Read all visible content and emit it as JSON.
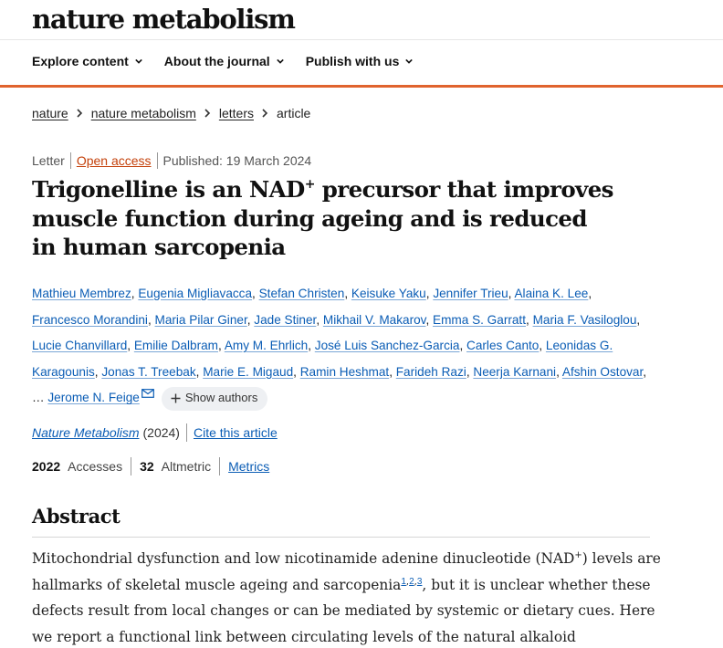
{
  "header": {
    "logo": "nature metabolism"
  },
  "nav": [
    {
      "label": "Explore content"
    },
    {
      "label": "About the journal"
    },
    {
      "label": "Publish with us"
    }
  ],
  "breadcrumbs": [
    "nature",
    "nature metabolism",
    "letters",
    "article"
  ],
  "meta": {
    "type": "Letter",
    "access": "Open access",
    "published": "Published: 19 March 2024"
  },
  "title": {
    "part1": "Trigonelline is an NAD",
    "sup": "+",
    "part2": " precursor that improves muscle function during ageing and is reduced in human sarcopenia"
  },
  "authors": [
    "Mathieu Membrez",
    "Eugenia Migliavacca",
    "Stefan Christen",
    "Keisuke Yaku",
    "Jennifer Trieu",
    "Alaina K. Lee",
    "Francesco Morandini",
    "Maria Pilar Giner",
    "Jade Stiner",
    "Mikhail V. Makarov",
    "Emma S. Garratt",
    "Maria F. Vasiloglou",
    "Lucie Chanvillard",
    "Emilie Dalbram",
    "Amy M. Ehrlich",
    "José Luis Sanchez-Garcia",
    "Carles Canto",
    "Leonidas G. Karagounis",
    "Jonas T. Treebak",
    "Marie E. Migaud",
    "Ramin Heshmat",
    "Farideh Razi",
    "Neerja Karnani",
    "Afshin Ostovar",
    "Jerome N. Feige"
  ],
  "authors_ellipsis": "…",
  "show_authors_label": "Show authors",
  "journal": {
    "name": "Nature Metabolism",
    "year": "(2024)",
    "cite": "Cite this article"
  },
  "metrics": {
    "accesses_value": "2022",
    "accesses_label": "Accesses",
    "altmetric_value": "32",
    "altmetric_label": "Altmetric",
    "metrics_link": "Metrics"
  },
  "abstract": {
    "heading": "Abstract",
    "p1": "Mitochondrial dysfunction and low nicotinamide adenine dinucleotide (NAD",
    "sup": "+",
    "p2": ") levels are hallmarks of skeletal muscle ageing and sarcopenia",
    "refs": [
      "1",
      "2",
      "3"
    ],
    "p3": ", but it is unclear whether these defects result from local changes or can be mediated by systemic or dietary cues. Here we report a functional link between circulating levels of the natural alkaloid trigonelline, which is"
  },
  "colors": {
    "accent_bar": "#e0632e",
    "link": "#0b5db5",
    "open_access": "#c4410b"
  },
  "icons": [
    "chevron-down-icon",
    "chevron-right-icon",
    "mail-icon",
    "plus-icon"
  ]
}
